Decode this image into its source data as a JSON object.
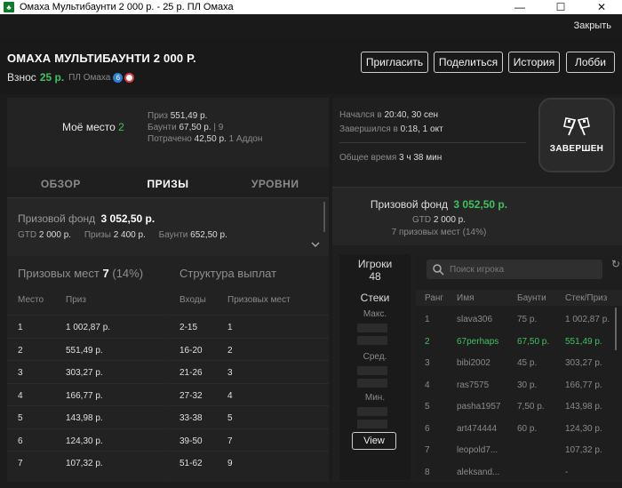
{
  "window": {
    "title": "Омаха Мультибаунти 2 000 р. - 25 р. ПЛ Омаха",
    "minimize": "—",
    "maximize": "☐",
    "close": "✕"
  },
  "topbar": {
    "close_label": "Закрыть"
  },
  "header": {
    "tournament_name": "ОМАХА МУЛЬТИБАУНТИ 2 000 Р.",
    "buyin_label": "Взнос",
    "buyin_value": "25 р.",
    "game_type": "ПЛ Омаха",
    "badge_number": "6",
    "buttons": {
      "invite": "Пригласить",
      "share": "Поделиться",
      "history": "История",
      "lobby": "Лобби"
    }
  },
  "my_info": {
    "place_label": "Моё место",
    "place_value": "2",
    "prize_label": "Приз",
    "prize_value": "551,49 р.",
    "bounty_label": "Баунти",
    "bounty_value": "67,50 р.",
    "bounty_count": "| 9",
    "spent_label": "Потрачено",
    "spent_value": "42,50 р.",
    "addon": "1 Аддон"
  },
  "tabs": [
    "ОБЗОР",
    "ПРИЗЫ",
    "УРОВНИ"
  ],
  "prize_pool": {
    "label": "Призовой фонд",
    "value": "3 052,50 р.",
    "gtd_label": "GTD",
    "gtd_value": "2 000 р.",
    "prizes_label": "Призы",
    "prizes_value": "2 400 р.",
    "bounty_label": "Баунти",
    "bounty_value": "652,50 р."
  },
  "prize_places": {
    "title": "Призовых мест",
    "count": "7",
    "percent": "(14%)",
    "col_place": "Место",
    "col_prize": "Приз",
    "rows": [
      [
        "1",
        "1 002,87 р."
      ],
      [
        "2",
        "551,49 р."
      ],
      [
        "3",
        "303,27 р."
      ],
      [
        "4",
        "166,77 р."
      ],
      [
        "5",
        "143,98 р."
      ],
      [
        "6",
        "124,30 р."
      ],
      [
        "7",
        "107,32 р."
      ]
    ]
  },
  "payout_structure": {
    "title": "Структура выплат",
    "col_entries": "Входы",
    "col_places": "Призовых мест",
    "rows": [
      [
        "2-15",
        "1"
      ],
      [
        "16-20",
        "2"
      ],
      [
        "21-26",
        "3"
      ],
      [
        "27-32",
        "4"
      ],
      [
        "33-38",
        "5"
      ],
      [
        "39-50",
        "7"
      ],
      [
        "51-62",
        "9"
      ]
    ]
  },
  "times": {
    "started_label": "Начался в",
    "started_value": "20:40, 30 сен",
    "ended_label": "Завершился в",
    "ended_value": "0:18, 1 окт",
    "total_label": "Общее время",
    "total_value": "3 ч 38 мин"
  },
  "status": {
    "label": "ЗАВЕРШЕН"
  },
  "right_pool": {
    "label": "Призовой фонд",
    "value": "3 052,50 р.",
    "gtd_label": "GTD",
    "gtd_value": "2 000 р.",
    "places_text": "7 призовых мест (14%)"
  },
  "players_stats": {
    "players_label": "Игроки",
    "players_count": "48",
    "stacks_label": "Стеки",
    "max_label": "Макс.",
    "avg_label": "Сред.",
    "min_label": "Мин.",
    "view_button": "View"
  },
  "players": {
    "search_placeholder": "Поиск игрока",
    "col_rank": "Ранг",
    "col_name": "Имя",
    "col_bounty": "Баунти",
    "col_stack": "Стек/Приз",
    "rows": [
      [
        "1",
        "slava306",
        "75 р.",
        "1 002,87 р."
      ],
      [
        "2",
        "67perhaps",
        "67,50 р.",
        "551,49 р."
      ],
      [
        "3",
        "bibi2002",
        "45 р.",
        "303,27 р."
      ],
      [
        "4",
        "ras7575",
        "30 р.",
        "166,77 р."
      ],
      [
        "5",
        "pasha1957",
        "7,50 р.",
        "143,98 р."
      ],
      [
        "6",
        "art474444",
        "60 р.",
        "124,30 р."
      ],
      [
        "7",
        "leopold7...",
        "",
        "107,32 р."
      ],
      [
        "8",
        "aleksand...",
        "",
        "-"
      ]
    ],
    "highlight_row": 1,
    "highlight_color": "#3fc25e"
  }
}
